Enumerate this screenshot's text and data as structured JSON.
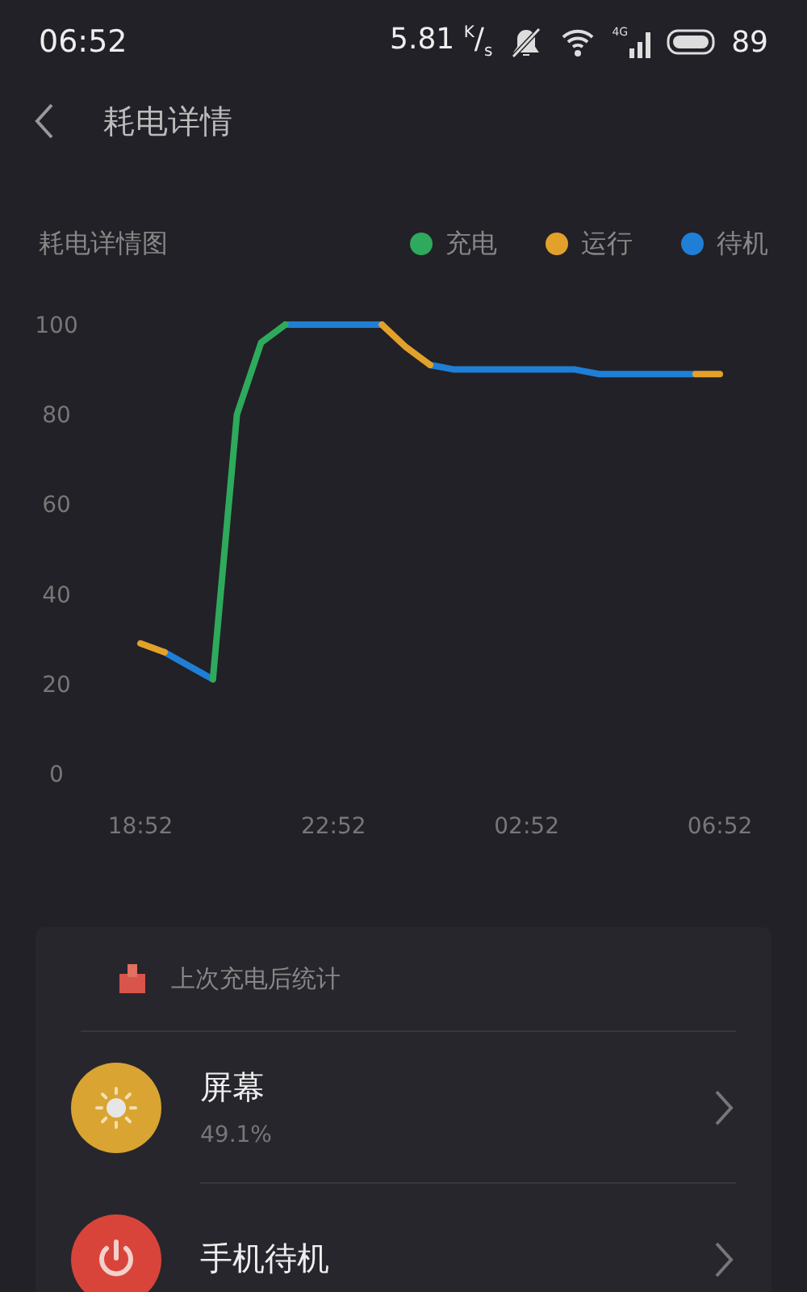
{
  "status_bar": {
    "time": "06:52",
    "net_speed": "5.81 $^{K}$/$_{s}$",
    "network_type": "4G",
    "battery": "89"
  },
  "header": {
    "title": "耗电详情"
  },
  "chart": {
    "chart_data": {
      "type": "line",
      "title": "耗电详情图",
      "categories": [
        "18:52",
        null,
        null,
        null,
        null,
        null,
        null,
        null,
        "22:52",
        null,
        null,
        null,
        null,
        null,
        null,
        null,
        "02:52",
        null,
        null,
        null,
        null,
        null,
        null,
        null,
        "06:52"
      ],
      "series": [
        {
          "name": "充电",
          "color": "#2eaa5c",
          "values": [
            null,
            null,
            null,
            21,
            80,
            96,
            100,
            null,
            null,
            null,
            null,
            null,
            null,
            null,
            null,
            null,
            null,
            null,
            null,
            null,
            null,
            null,
            null,
            null,
            null
          ]
        },
        {
          "name": "运行",
          "color": "#e2a12a",
          "values": [
            29,
            27,
            null,
            null,
            null,
            null,
            null,
            null,
            null,
            null,
            100,
            95,
            91,
            null,
            null,
            null,
            null,
            null,
            null,
            null,
            null,
            null,
            null,
            89,
            89
          ]
        },
        {
          "name": "待机",
          "color": "#1f7fd6",
          "values": [
            null,
            27,
            24,
            21,
            null,
            null,
            100,
            100,
            100,
            100,
            100,
            null,
            91,
            90,
            90,
            90,
            90,
            90,
            90,
            89,
            89,
            89,
            89,
            89,
            null
          ]
        }
      ],
      "ylim": [
        0,
        100
      ],
      "yticks": [
        0,
        20,
        40,
        60,
        80,
        100
      ]
    }
  },
  "stats": {
    "title": "上次充电后统计",
    "items": [
      {
        "kind": "screen",
        "name": "屏幕",
        "percent": "49.1%",
        "color": "#d9a431"
      },
      {
        "kind": "standby",
        "name": "手机待机",
        "color": "#d9443a"
      }
    ]
  }
}
